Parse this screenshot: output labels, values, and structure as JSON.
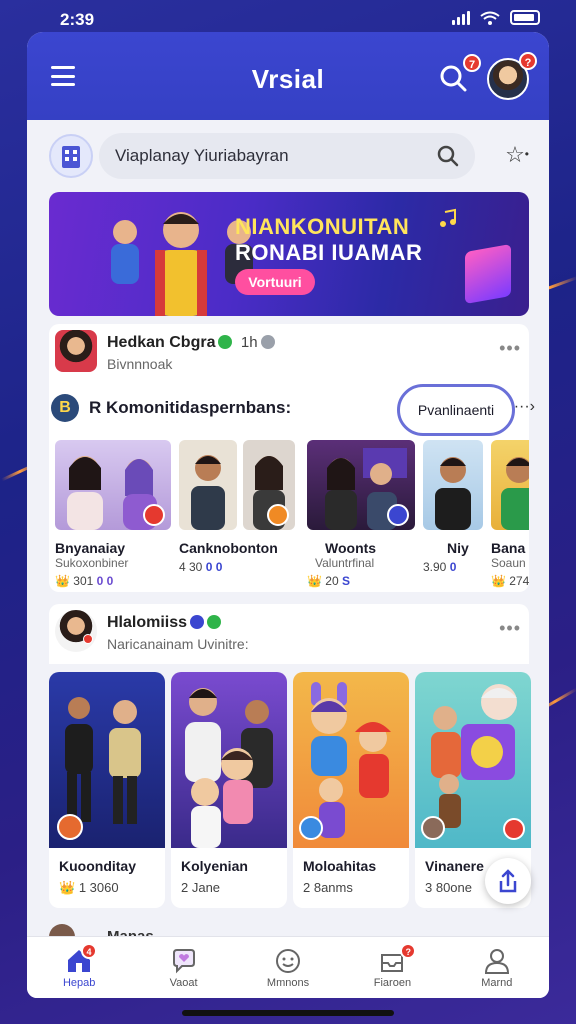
{
  "status_bar": {
    "time": "2:39"
  },
  "header": {
    "title": "Vrsial",
    "search_badge": "7",
    "avatar_badge": "?"
  },
  "search": {
    "placeholder": "Viaplanay Yiuriabayran"
  },
  "banner": {
    "line1": "NIANKONUITAN",
    "line2": "RONABI IUAMAR",
    "button": "Vortuuri"
  },
  "post1": {
    "name": "Hedkan Cbgra",
    "time": "1h",
    "subtitle": "Bivnnnoak",
    "section_title": "R Komonitidaspernbans:",
    "pill_button": "Pvanlinaenti",
    "creators": [
      {
        "name": "Bnyanaiay",
        "meta": "Sukoxonbiner",
        "stats": "301",
        "stat_badges": "0 0"
      },
      {
        "name": "Canknobonton",
        "meta": "",
        "stats": "4 30",
        "stat_badges": "0 0"
      },
      {
        "name": "Woonts",
        "meta": "Valuntrfinal",
        "stats": "20",
        "stat_badges": "S"
      },
      {
        "name": "Niy",
        "meta": "",
        "stats": "3.90",
        "stat_badges": "0"
      },
      {
        "name": "Bana",
        "meta": "Soaun",
        "stats": "274",
        "stat_badges": ""
      }
    ]
  },
  "post2": {
    "name": "Hlalomiiss",
    "subtitle": "Naricanainam Uvinitre:",
    "tiles": [
      {
        "title": "Kuoonditay",
        "meta": "1 3060"
      },
      {
        "title": "Kolyenian",
        "meta": "2 Jane"
      },
      {
        "title": "Moloahitas",
        "meta": "2 8anms"
      },
      {
        "title": "Vinanere",
        "meta": "3 80one"
      }
    ]
  },
  "peek": {
    "text": "Manas"
  },
  "bottom_nav": {
    "items": [
      {
        "label": "Hepab",
        "badge": "4"
      },
      {
        "label": "Vaoat"
      },
      {
        "label": "Mmnons"
      },
      {
        "label": "Fiaroen",
        "badge": "?"
      },
      {
        "label": "Marnd"
      }
    ]
  },
  "colors": {
    "primary": "#3b46d0",
    "badge_red": "#e5392f",
    "banner_pink": "#ff4fa0",
    "banner_yellow": "#ffe45c"
  }
}
